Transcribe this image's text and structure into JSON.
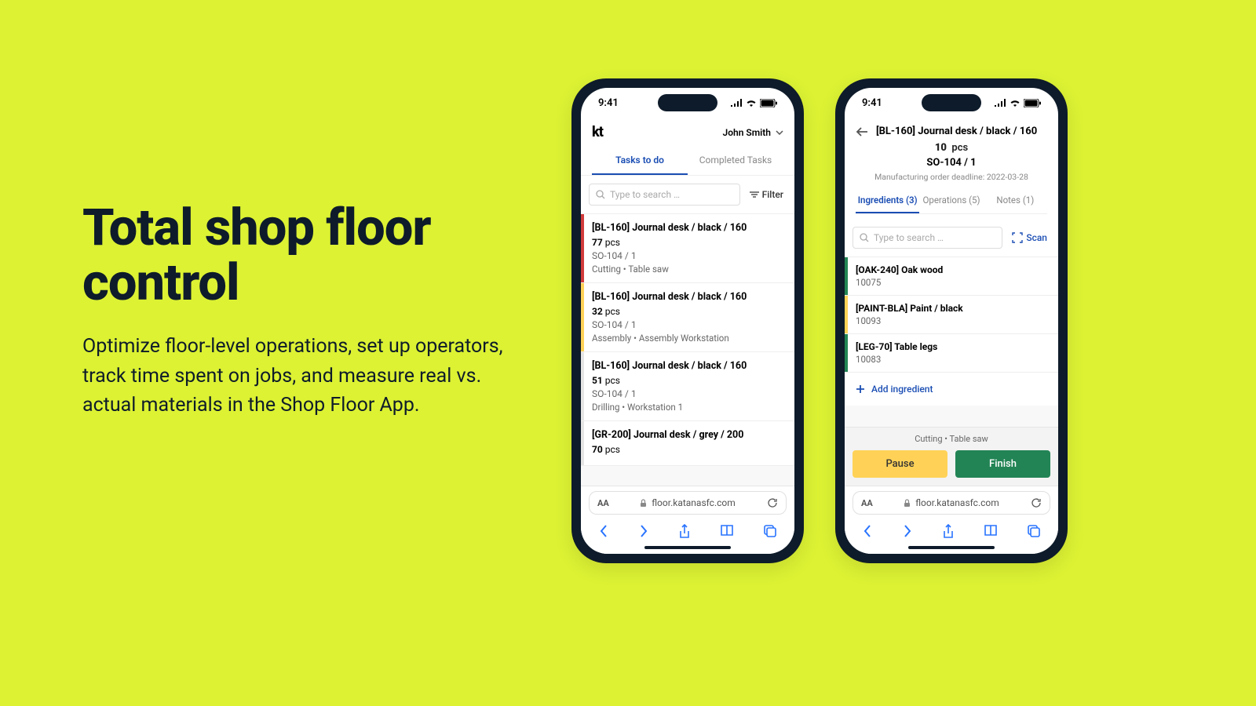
{
  "hero": {
    "title": "Total shop floor control",
    "body": "Optimize floor-level operations, set up operators, track time spent on jobs, and measure real vs. actual materials in the Shop Floor App."
  },
  "status": {
    "time": "9:41"
  },
  "browser": {
    "url": "floor.katanasfc.com"
  },
  "phone1": {
    "logo": "kt",
    "user": "John Smith",
    "tabs": {
      "todo": "Tasks to do",
      "done": "Completed Tasks"
    },
    "search_placeholder": "Type to search …",
    "filter_label": "Filter",
    "tasks": [
      {
        "stripe": "#d23b3b",
        "title": "[BL-160] Journal desk / black / 160",
        "qty": "77",
        "unit": "pcs",
        "so": "SO-104 / 1",
        "op": "Cutting  •  Table saw"
      },
      {
        "stripe": "#ffd257",
        "title": "[BL-160] Journal desk / black / 160",
        "qty": "32",
        "unit": "pcs",
        "so": "SO-104 / 1",
        "op": "Assembly  •  Assembly Workstation"
      },
      {
        "stripe": "#e5e5e5",
        "title": "[BL-160] Journal desk / black / 160",
        "qty": "51",
        "unit": "pcs",
        "so": "SO-104 / 1",
        "op": "Drilling  •  Workstation 1"
      },
      {
        "stripe": "#e5e5e5",
        "title": "[GR-200] Journal desk / grey / 200",
        "qty": "70",
        "unit": "pcs",
        "so": "",
        "op": ""
      }
    ]
  },
  "phone2": {
    "title": "[BL-160] Journal desk / black / 160",
    "qty": "10",
    "unit": "pcs",
    "so": "SO-104 / 1",
    "deadline": "Manufacturing order deadline: 2022-03-28",
    "tabs": {
      "ing": "Ingredients (3)",
      "ops": "Operations (5)",
      "notes": "Notes (1)"
    },
    "search_placeholder": "Type to search …",
    "scan_label": "Scan",
    "ingredients": [
      {
        "stripe": "#228455",
        "title": "[OAK-240] Oak wood",
        "num": "10075"
      },
      {
        "stripe": "#ffd257",
        "title": "[PAINT-BLA] Paint / black",
        "num": "10093"
      },
      {
        "stripe": "#228455",
        "title": "[LEG-70] Table legs",
        "num": "10083"
      }
    ],
    "add_ing": "Add ingredient",
    "action_label": "Cutting  •  Table saw",
    "pause": "Pause",
    "finish": "Finish"
  }
}
